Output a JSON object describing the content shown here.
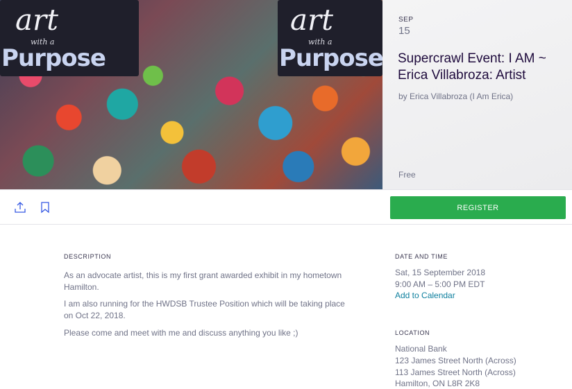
{
  "hero": {
    "image_text": {
      "left": {
        "word1": "art",
        "word2": "with a",
        "word3": "Purpose"
      },
      "right": {
        "word1": "art",
        "word2": "with a",
        "word3": "Purpose"
      }
    },
    "date_month": "SEP",
    "date_day": "15",
    "title": "Supercrawl Event: I AM ~ Erica Villabroza: Artist",
    "organizer": "by Erica Villabroza (I Am Erica)",
    "price": "Free"
  },
  "actions": {
    "share_icon": "share-icon",
    "bookmark_icon": "bookmark-icon",
    "register_label": "REGISTER",
    "register_color": "#2aac4e"
  },
  "description": {
    "heading": "DESCRIPTION",
    "paragraphs": [
      "As an advocate artist, this is my first grant awarded exhibit in my hometown Hamilton.",
      "I am also running for the HWDSB Trustee Position which will be taking place on Oct 22, 2018.",
      "Please come and meet with me and discuss anything you like ;)"
    ]
  },
  "date_time": {
    "heading": "DATE AND TIME",
    "date": "Sat, 15 September 2018",
    "time": "9:00 AM – 5:00 PM EDT",
    "add_to_calendar": "Add to Calendar",
    "link_color": "#0d7f9e"
  },
  "location": {
    "heading": "LOCATION",
    "lines": [
      "National Bank",
      "123 James Street North (Across)",
      "113 James Street North (Across)",
      "Hamilton, ON L8R 2K8"
    ]
  }
}
